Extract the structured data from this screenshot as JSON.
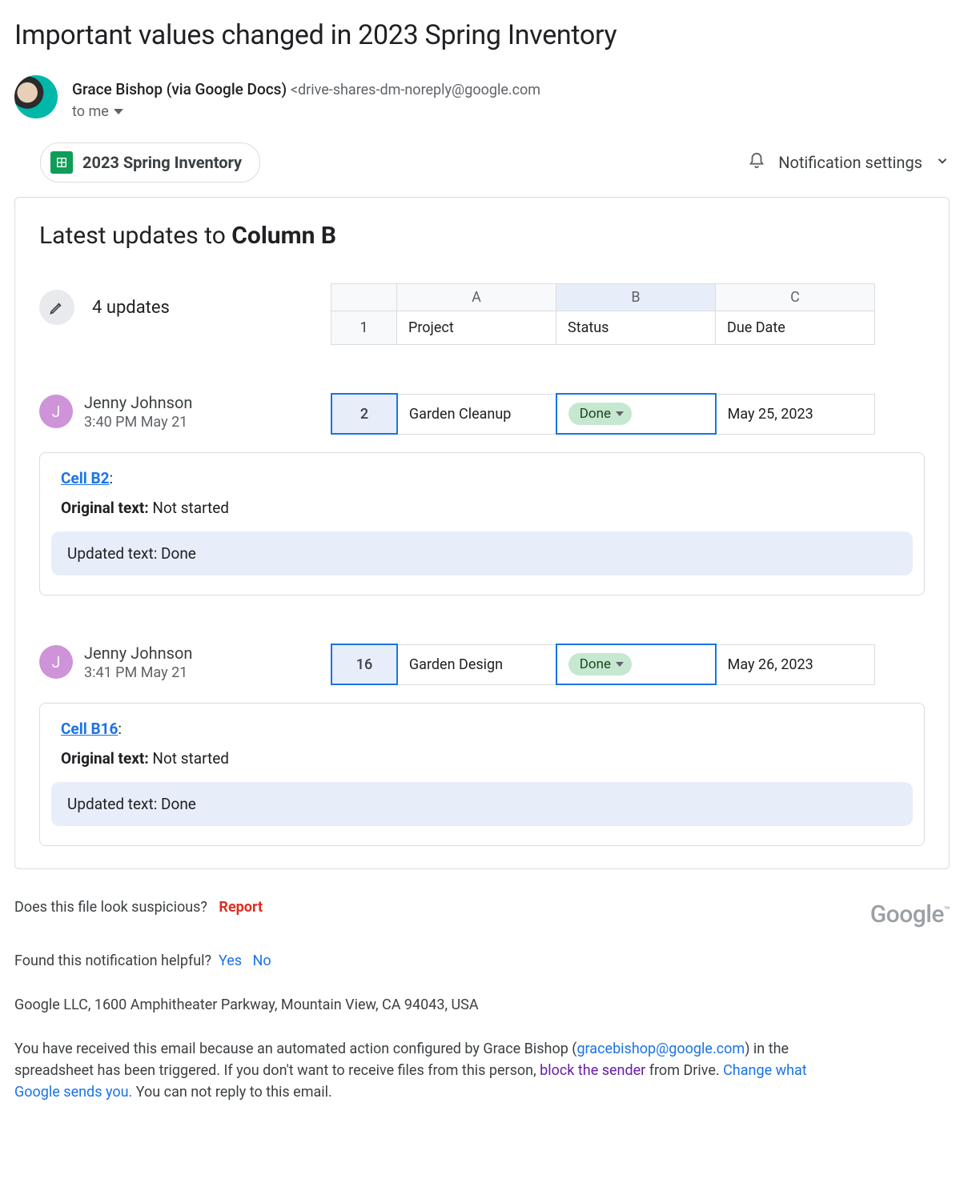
{
  "email": {
    "subject": "Important values changed in 2023 Spring Inventory",
    "from_name": "Grace Bishop (via Google Docs)",
    "from_email": "<drive-shares-dm-noreply@google.com",
    "to_label": "to me"
  },
  "chip": {
    "label": "2023 Spring Inventory"
  },
  "notification_settings_label": "Notification settings",
  "card": {
    "title_prefix": "Latest updates to ",
    "title_bold": "Column B",
    "updates_count_label": "4 updates",
    "header_table": {
      "cols": [
        "A",
        "B",
        "C"
      ],
      "row_num": "1",
      "cells": [
        "Project",
        "Status",
        "Due Date"
      ]
    }
  },
  "updates": [
    {
      "initial": "J",
      "name": "Jenny Johnson",
      "time": "3:40 PM May 21",
      "row_num": "2",
      "project": "Garden Cleanup",
      "status_pill": "Done",
      "due": "May 25, 2023",
      "cell_link": "Cell B2",
      "original_label": "Original text:",
      "original_value": " Not started",
      "updated_label": "Updated text:",
      "updated_value": " Done"
    },
    {
      "initial": "J",
      "name": "Jenny Johnson",
      "time": "3:41 PM May 21",
      "row_num": "16",
      "project": "Garden Design",
      "status_pill": "Done",
      "due": "May 26, 2023",
      "cell_link": "Cell B16",
      "original_label": "Original text:",
      "original_value": " Not started",
      "updated_label": "Updated text:",
      "updated_value": " Done"
    }
  ],
  "footer": {
    "suspicious_q": "Does this file look suspicious?",
    "report": "Report",
    "google_logo": "Google",
    "helpful_q": "Found this notification helpful?",
    "yes": "Yes",
    "no": "No",
    "address": "Google LLC, 1600 Amphitheater Parkway, Mountain View, CA 94043, USA",
    "explain_1": "You have received this email because an automated action configured by Grace Bishop (",
    "explain_email": "gracebishop@google.com",
    "explain_2": ") in the spreadsheet has been triggered. If you don't want to receive files from this person, ",
    "block_sender": "block the sender",
    "explain_3": " from Drive. ",
    "change_link": "Change what Google sends you.",
    "explain_4": " You can not reply to this email."
  }
}
